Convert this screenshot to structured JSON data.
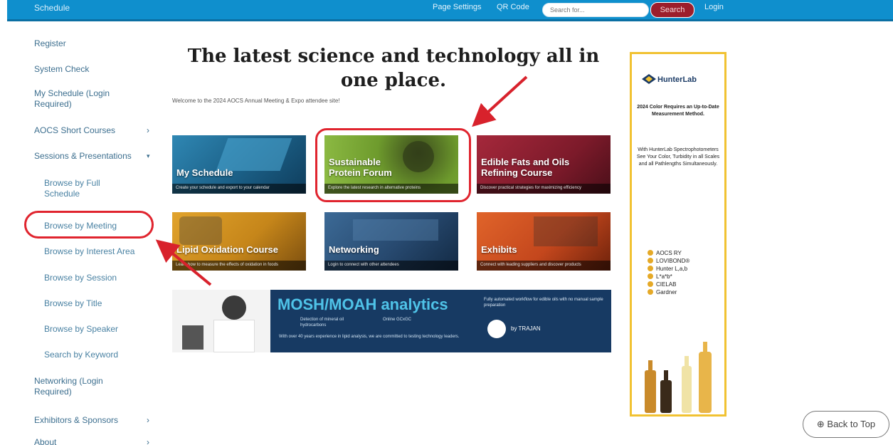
{
  "topbar": {
    "brand": "Schedule",
    "page_settings": "Page Settings",
    "qr_code": "QR Code",
    "search_placeholder": "Search for...",
    "search_button": "Search",
    "login": "Login"
  },
  "sidebar": {
    "items": [
      {
        "label": "Register"
      },
      {
        "label": "System Check"
      },
      {
        "label": "My Schedule (Login\nRequired)"
      },
      {
        "label": "AOCS Short Courses"
      },
      {
        "label": "Sessions & Presentations"
      },
      {
        "label": "Browse by Full\nSchedule"
      },
      {
        "label": "Browse by Meeting"
      },
      {
        "label": "Browse by Interest Area"
      },
      {
        "label": "Browse by Session"
      },
      {
        "label": "Browse by Title"
      },
      {
        "label": "Browse by Speaker"
      },
      {
        "label": "Search by Keyword"
      },
      {
        "label": "Networking (Login\nRequired)"
      },
      {
        "label": "Exhibitors & Sponsors"
      },
      {
        "label": "About"
      }
    ]
  },
  "main": {
    "title": "The latest science and technology all in one place.",
    "welcome": "Welcome to the 2024 AOCS Annual Meeting & Expo attendee site!",
    "tiles": [
      {
        "title": "My Schedule",
        "subtitle": "Create your schedule and export to your calendar",
        "color": "#1f6d95"
      },
      {
        "title": "Sustainable\nProtein Forum",
        "subtitle": "Explore the latest research in alternative proteins",
        "color": "#7fae3b"
      },
      {
        "title": "Edible Fats and Oils\nRefining Course",
        "subtitle": "Discover practical strategies for maximizing efficiency",
        "color": "#8c1e2f"
      },
      {
        "title": "Lipid Oxidation Course",
        "subtitle": "Learn how to measure the effects of oxidation in foods",
        "color": "#c98a1b"
      },
      {
        "title": "Networking",
        "subtitle": "Login to connect with other attendees",
        "color": "#27496f"
      },
      {
        "title": "Exhibits",
        "subtitle": "Connect with leading suppliers and discover products",
        "color": "#c4471d"
      }
    ]
  },
  "banner": {
    "headline": "MOSH/MOAH analytics",
    "tagline": "Fully automated workflow for edible oils with no manual sample preparation",
    "bullet1": "Detection of mineral oil hydrocarbons",
    "bullet2": "Online GCxGC",
    "footnote": "With over 40 years experience in lipid analysis, we are committed to testing technology leaders.",
    "vendor": "by TRAJAN"
  },
  "ad": {
    "brand": "HunterLab",
    "lead": "2024 Color Requires an Up-to-Date Measurement Method.",
    "body": "With HunterLab Spectrophotometers See Your Color, Turbidity in all Scales and all Pathlengths Simultaneously.",
    "scales": [
      "AOCS RY",
      "LOVIBOND®",
      "Hunter L,a,b",
      "L*a*b*",
      "CIELAB",
      "Gardner"
    ],
    "border_color": "#f1c232"
  },
  "back_to_top": "⊕ Back to Top"
}
